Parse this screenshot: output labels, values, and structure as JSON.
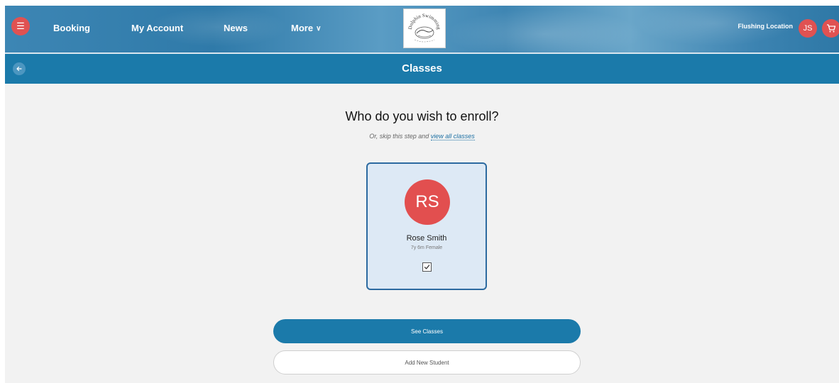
{
  "nav": {
    "items": [
      {
        "label": "Booking"
      },
      {
        "label": "My Account"
      },
      {
        "label": "News"
      },
      {
        "label": "More"
      }
    ],
    "location": "Flushing Location",
    "user_initials": "JS"
  },
  "logo": {
    "text": "Dolphin Swimming"
  },
  "titlebar": {
    "title": "Classes"
  },
  "main": {
    "heading": "Who do you wish to enroll?",
    "skip_prefix": "Or, skip this step and",
    "skip_link": "view all classes"
  },
  "student": {
    "initials": "RS",
    "name": "Rose Smith",
    "meta": "7y 6m Female",
    "selected": true
  },
  "actions": {
    "primary": "See Classes",
    "secondary": "Add New Student"
  },
  "colors": {
    "primary": "#1b7aaa",
    "accent_red": "#e05252",
    "card_bg": "#dde9f5",
    "card_border": "#2c6aa0"
  },
  "icons": {
    "menu": "menu-icon",
    "chevron": "chevron-down-icon",
    "cart": "cart-icon",
    "back": "back-arrow-icon",
    "check": "check-icon"
  }
}
